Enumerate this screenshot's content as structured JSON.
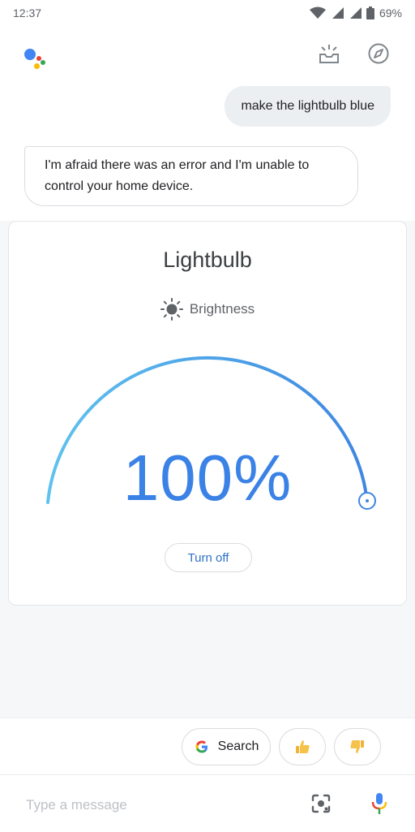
{
  "status_bar": {
    "time": "12:37",
    "battery": "69%"
  },
  "conversation": {
    "user_message": "make the lightbulb blue",
    "assistant_reply": "I'm afraid there was an error and I'm unable to control your home device."
  },
  "device_card": {
    "title": "Lightbulb",
    "brightness_label": "Brightness",
    "brightness_value": "100%",
    "brightness_level": 1.0,
    "turn_off_label": "Turn off",
    "accent_color": "#3b82e6"
  },
  "suggestions": {
    "search_label": "Search",
    "thumbs_up_icon": "thumbs-up-icon",
    "thumbs_down_icon": "thumbs-down-icon"
  },
  "composer": {
    "placeholder": "Type a message",
    "lens_icon": "lens-icon",
    "mic_icon": "mic-icon"
  }
}
